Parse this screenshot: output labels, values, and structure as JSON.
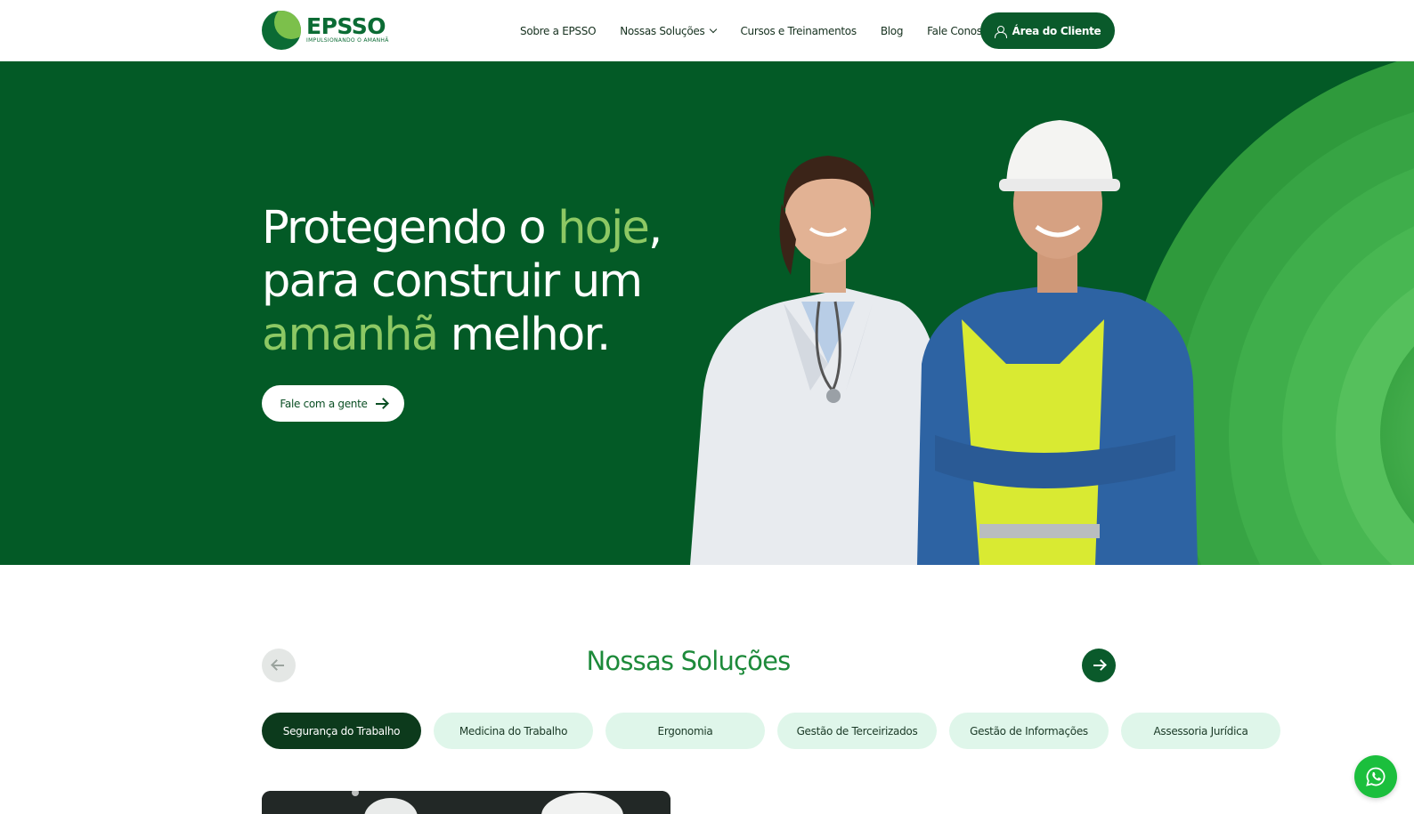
{
  "header": {
    "logo": {
      "name": "EPSSO",
      "tagline": "IMPULSIONANDO O AMANHÃ"
    },
    "nav": [
      {
        "label": "Sobre a EPSSO"
      },
      {
        "label": "Nossas Soluções",
        "has_dropdown": true
      },
      {
        "label": "Cursos e Treinamentos"
      },
      {
        "label": "Blog"
      },
      {
        "label": "Fale Conosco"
      }
    ],
    "client_button": {
      "label": "Área do Cliente",
      "icon": "user-icon"
    }
  },
  "hero": {
    "title_parts": {
      "p1": "Protegendo o ",
      "hl1": "hoje",
      "p2": ",",
      "p3": "para construir um",
      "hl2": "amanhã",
      "p4": " melhor."
    },
    "cta_label": "Fale com a gente",
    "cta_icon": "arrow-right-icon",
    "image": "doctor-and-construction-worker"
  },
  "solutions": {
    "title": "Nossas Soluções",
    "prev_icon": "arrow-left-icon",
    "next_icon": "arrow-right-icon",
    "tabs": [
      {
        "label": "Segurança do Trabalho",
        "active": true
      },
      {
        "label": "Medicina do Trabalho",
        "active": false
      },
      {
        "label": "Ergonomia",
        "active": false
      },
      {
        "label": "Gestão de Terceirizados",
        "active": false
      },
      {
        "label": "Gestão de Informações",
        "active": false
      },
      {
        "label": "Assessoria Jurídica",
        "active": false
      }
    ]
  },
  "floating": {
    "whatsapp_icon": "whatsapp-icon"
  },
  "colors": {
    "brand_dark": "#0a5a2b",
    "hero_bg": "#035a26",
    "accent_green": "#8dc864",
    "tab_bg": "#dff6ea",
    "tab_active_bg": "#0c3a1c",
    "whatsapp": "#1bbf3d"
  }
}
